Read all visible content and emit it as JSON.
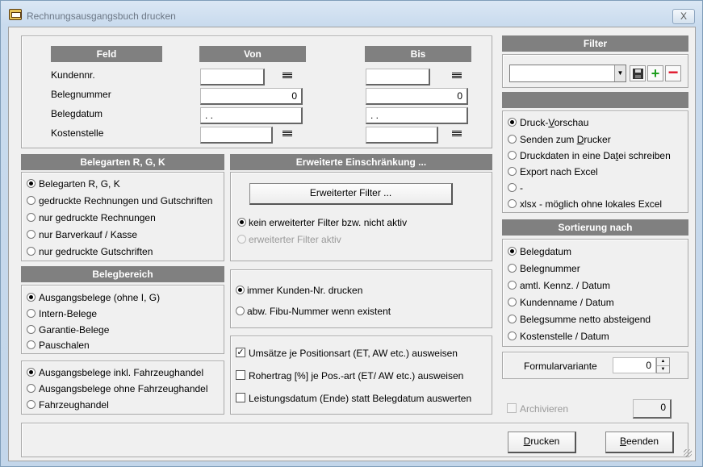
{
  "window": {
    "title": "Rechnungsausgangsbuch drucken",
    "close": "X"
  },
  "fields": {
    "header_feld": "Feld",
    "header_von": "Von",
    "header_bis": "Bis",
    "rows": [
      {
        "label": "Kundennr.",
        "von": "",
        "bis": ""
      },
      {
        "label": "Belegnummer",
        "von": "0",
        "bis": "0"
      },
      {
        "label": "Belegdatum",
        "von": ". .",
        "bis": ". ."
      },
      {
        "label": "Kostenstelle",
        "von": "",
        "bis": ""
      }
    ],
    "lookup_icon": "list-icon"
  },
  "belegarten": {
    "title": "Belegarten R, G, K",
    "options": [
      "Belegarten R, G, K",
      "gedruckte Rechnungen und Gutschriften",
      "nur gedruckte Rechnungen",
      "nur Barverkauf / Kasse",
      "nur gedruckte Gutschriften"
    ],
    "selected": 0
  },
  "erweitert": {
    "title": "Erweiterte Einschränkung ...",
    "button": "Erweiterter Filter ...",
    "options": [
      "kein erweiterter Filter bzw. nicht aktiv",
      "erweiterter Filter aktiv"
    ],
    "selected": 0
  },
  "belegbereich": {
    "title": "Belegbereich",
    "options": [
      "Ausgangsbelege (ohne I, G)",
      "Intern-Belege",
      "Garantie-Belege",
      "Pauschalen"
    ],
    "selected": 0
  },
  "fahrzeug": {
    "options": [
      "Ausgangsbelege inkl. Fahrzeughandel",
      "Ausgangsbelege ohne Fahrzeughandel",
      "Fahrzeughandel"
    ],
    "selected": 0
  },
  "kunden": {
    "options": [
      "immer Kunden-Nr. drucken",
      "abw. Fibu-Nummer wenn existent"
    ],
    "selected": 0
  },
  "checks": [
    {
      "label": "Umsätze  je Positionsart (ET, AW etc.) ausweisen",
      "checked": true
    },
    {
      "label": "Rohertrag [%]  je Pos.-art (ET/ AW etc.) ausweisen",
      "checked": false
    },
    {
      "label": "Leistungsdatum (Ende) statt Belegdatum auswerten",
      "checked": false
    }
  ],
  "filter": {
    "title": "Filter",
    "value": "",
    "save_icon": "save-icon",
    "add_icon": "plus-icon",
    "remove_icon": "minus-icon"
  },
  "output": {
    "options": [
      {
        "pre": "Druck-",
        "u": "V",
        "post": "orschau"
      },
      {
        "pre": "Senden zum ",
        "u": "D",
        "post": "rucker"
      },
      {
        "pre": "Druckdaten in eine Da",
        "u": "t",
        "post": "ei schreiben"
      },
      {
        "pre": "Export nach Excel",
        "u": "",
        "post": ""
      },
      {
        "pre": "-",
        "u": "",
        "post": ""
      },
      {
        "pre": "xlsx - möglich ohne lokales Excel",
        "u": "",
        "post": ""
      }
    ],
    "selected": 0
  },
  "sortierung": {
    "title": "Sortierung nach",
    "options": [
      "Belegdatum",
      "Belegnummer",
      "amtl. Kennz. / Datum",
      "Kundenname / Datum",
      "Belegsumme netto absteigend",
      "Kostenstelle / Datum"
    ],
    "selected": 0
  },
  "formularvariante": {
    "label": "Formularvariante",
    "value": "0"
  },
  "archivieren": {
    "label": "Archivieren",
    "value": "0"
  },
  "buttons": {
    "drucken": {
      "u": "D",
      "rest": "rucken"
    },
    "beenden": {
      "u": "B",
      "rest": "eenden"
    }
  }
}
